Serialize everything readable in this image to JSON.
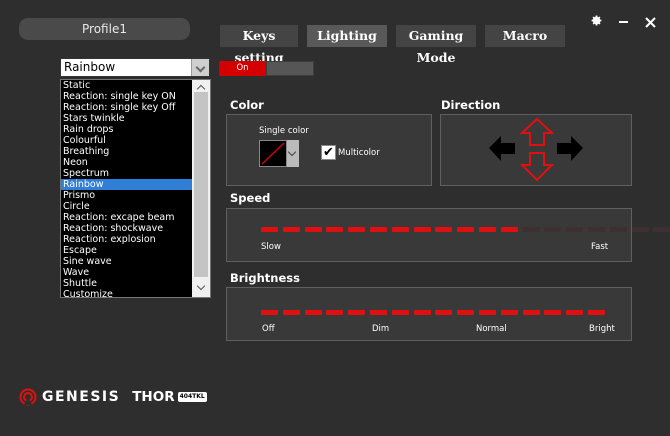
{
  "profile": {
    "label": "Profile1"
  },
  "tabs": [
    {
      "label": "Keys setting",
      "active": false
    },
    {
      "label": "Lighting",
      "active": true
    },
    {
      "label": "Gaming Mode",
      "active": false
    },
    {
      "label": "Macro",
      "active": false
    }
  ],
  "window_controls": [
    "gear-icon",
    "minimize-icon",
    "close-icon"
  ],
  "effect": {
    "selected": "Rainbow",
    "options": [
      "Static",
      "Reaction: single key ON",
      "Reaction: single key Off",
      "Stars twinkle",
      "Rain drops",
      "Colourful",
      "Breathing",
      "Neon",
      "Spectrum",
      "Rainbow",
      "Prismo",
      "Circle",
      "Reaction: excape beam",
      "Reaction: shockwave",
      "Reaction: explosion",
      "Escape",
      "Sine wave",
      "Wave",
      "Shuttle",
      "Customize"
    ]
  },
  "toggle": {
    "on_label": "On",
    "state": "on"
  },
  "color": {
    "title": "Color",
    "single_color_label": "Single color",
    "multicolor_label": "Multicolor",
    "multicolor_checked": true,
    "check_glyph": "✔"
  },
  "direction": {
    "title": "Direction",
    "active": [
      "up",
      "down"
    ]
  },
  "speed": {
    "title": "Speed",
    "segments": 20,
    "level": 12,
    "min_label": "Slow",
    "max_label": "Fast"
  },
  "brightness": {
    "title": "Brightness",
    "segments": 16,
    "level": 16,
    "labels": {
      "off": "Off",
      "dim": "Dim",
      "normal": "Normal",
      "bright": "Bright"
    }
  },
  "brand": {
    "name": "GENESIS",
    "model": "THOR",
    "model_badge": "404TKL"
  },
  "colors": {
    "accent": "#d40000",
    "led_off": "#3e3030",
    "selection": "#2f7fd7"
  }
}
